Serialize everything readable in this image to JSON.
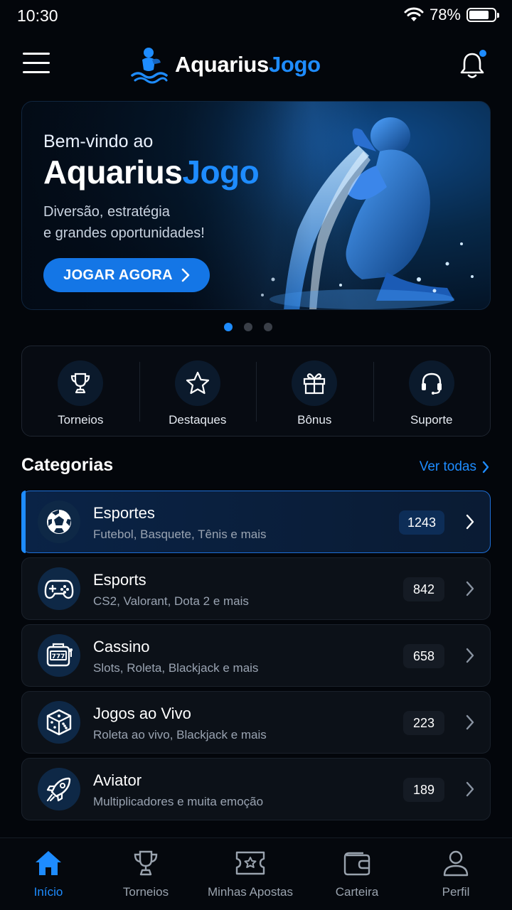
{
  "status": {
    "time": "10:30",
    "battery": "78%",
    "battery_level": 0.78
  },
  "header": {
    "logo_main": "Aquarius",
    "logo_accent": "Jogo"
  },
  "hero": {
    "subtitle": "Bem-vindo ao",
    "title_main": "Aquarius",
    "title_accent": "Jogo",
    "desc_line1": "Diversão, estratégia",
    "desc_line2": "e grandes oportunidades!",
    "cta": "JOGAR AGORA"
  },
  "carousel": {
    "active_index": 0,
    "count": 3
  },
  "quick_actions": [
    {
      "label": "Torneios",
      "icon": "trophy-icon"
    },
    {
      "label": "Destaques",
      "icon": "star-icon"
    },
    {
      "label": "Bônus",
      "icon": "gift-icon"
    },
    {
      "label": "Suporte",
      "icon": "headset-icon"
    }
  ],
  "categories": {
    "title": "Categorias",
    "see_all": "Ver todas",
    "items": [
      {
        "name": "Esportes",
        "sub": "Futebol, Basquete, Tênis e mais",
        "count": "1243",
        "icon": "soccer-ball-icon"
      },
      {
        "name": "Esports",
        "sub": "CS2, Valorant, Dota 2 e mais",
        "count": "842",
        "icon": "gamepad-icon"
      },
      {
        "name": "Cassino",
        "sub": "Slots, Roleta, Blackjack e mais",
        "count": "658",
        "icon": "slot-machine-icon"
      },
      {
        "name": "Jogos ao Vivo",
        "sub": "Roleta ao vivo, Blackjack e mais",
        "count": "223",
        "icon": "dice-icon"
      },
      {
        "name": "Aviator",
        "sub": "Multiplicadores e muita emoção",
        "count": "189",
        "icon": "rocket-icon"
      }
    ]
  },
  "nav": [
    {
      "label": "Início",
      "icon": "home-icon",
      "active": true
    },
    {
      "label": "Torneios",
      "icon": "trophy-icon"
    },
    {
      "label": "Minhas Apostas",
      "icon": "ticket-icon"
    },
    {
      "label": "Carteira",
      "icon": "wallet-icon"
    },
    {
      "label": "Perfil",
      "icon": "user-icon"
    }
  ],
  "colors": {
    "accent": "#1e8cff",
    "background": "#03060b",
    "card": "#0c1118"
  }
}
